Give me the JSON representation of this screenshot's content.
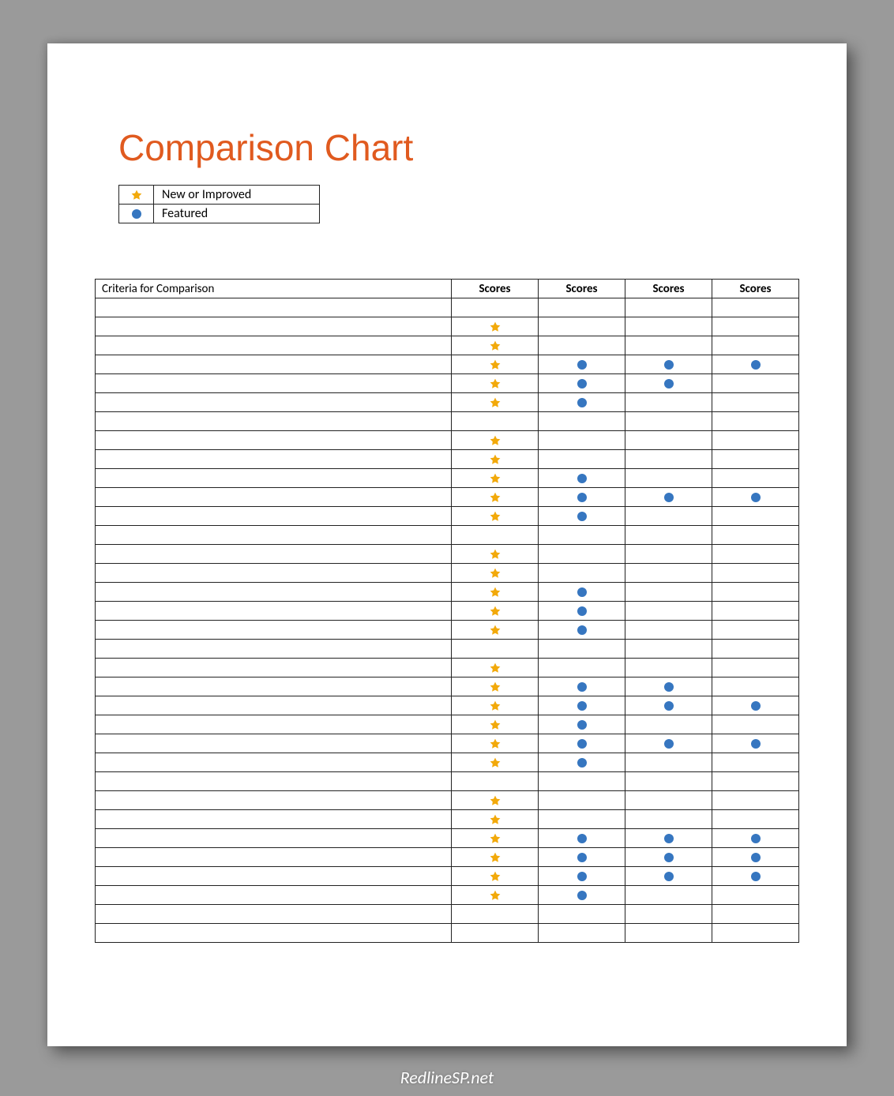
{
  "title": "Comparison Chart",
  "legend": [
    {
      "mark": "star",
      "label": "New or Improved"
    },
    {
      "mark": "dot",
      "label": "Featured"
    }
  ],
  "headers": {
    "criteria": "Criteria for Comparison",
    "scores": [
      "Scores",
      "Scores",
      "Scores",
      "Scores"
    ]
  },
  "rows": [
    {
      "criteria": "",
      "marks": [
        "",
        "",
        "",
        ""
      ]
    },
    {
      "criteria": "",
      "marks": [
        "star",
        "",
        "",
        ""
      ]
    },
    {
      "criteria": "",
      "marks": [
        "star",
        "",
        "",
        ""
      ]
    },
    {
      "criteria": "",
      "marks": [
        "star",
        "dot",
        "dot",
        "dot"
      ]
    },
    {
      "criteria": "",
      "marks": [
        "star",
        "dot",
        "dot",
        ""
      ]
    },
    {
      "criteria": "",
      "marks": [
        "star",
        "dot",
        "",
        ""
      ]
    },
    {
      "criteria": "",
      "marks": [
        "",
        "",
        "",
        ""
      ]
    },
    {
      "criteria": "",
      "marks": [
        "star",
        "",
        "",
        ""
      ]
    },
    {
      "criteria": "",
      "marks": [
        "star",
        "",
        "",
        ""
      ]
    },
    {
      "criteria": "",
      "marks": [
        "star",
        "dot",
        "",
        ""
      ]
    },
    {
      "criteria": "",
      "marks": [
        "star",
        "dot",
        "dot",
        "dot"
      ]
    },
    {
      "criteria": "",
      "marks": [
        "star",
        "dot",
        "",
        ""
      ]
    },
    {
      "criteria": "",
      "marks": [
        "",
        "",
        "",
        ""
      ]
    },
    {
      "criteria": "",
      "marks": [
        "star",
        "",
        "",
        ""
      ]
    },
    {
      "criteria": "",
      "marks": [
        "star",
        "",
        "",
        ""
      ]
    },
    {
      "criteria": "",
      "marks": [
        "star",
        "dot",
        "",
        ""
      ]
    },
    {
      "criteria": "",
      "marks": [
        "star",
        "dot",
        "",
        ""
      ]
    },
    {
      "criteria": "",
      "marks": [
        "star",
        "dot",
        "",
        ""
      ]
    },
    {
      "criteria": "",
      "marks": [
        "",
        "",
        "",
        ""
      ]
    },
    {
      "criteria": "",
      "marks": [
        "star",
        "",
        "",
        ""
      ]
    },
    {
      "criteria": "",
      "marks": [
        "star",
        "dot",
        "dot",
        ""
      ]
    },
    {
      "criteria": "",
      "marks": [
        "star",
        "dot",
        "dot",
        "dot"
      ]
    },
    {
      "criteria": "",
      "marks": [
        "star",
        "dot",
        "",
        ""
      ]
    },
    {
      "criteria": "",
      "marks": [
        "star",
        "dot",
        "dot",
        "dot"
      ]
    },
    {
      "criteria": "",
      "marks": [
        "star",
        "dot",
        "",
        ""
      ]
    },
    {
      "criteria": "",
      "marks": [
        "",
        "",
        "",
        ""
      ]
    },
    {
      "criteria": "",
      "marks": [
        "star",
        "",
        "",
        ""
      ]
    },
    {
      "criteria": "",
      "marks": [
        "star",
        "",
        "",
        ""
      ]
    },
    {
      "criteria": "",
      "marks": [
        "star",
        "dot",
        "dot",
        "dot"
      ]
    },
    {
      "criteria": "",
      "marks": [
        "star",
        "dot",
        "dot",
        "dot"
      ]
    },
    {
      "criteria": "",
      "marks": [
        "star",
        "dot",
        "dot",
        "dot"
      ]
    },
    {
      "criteria": "",
      "marks": [
        "star",
        "dot",
        "",
        ""
      ]
    },
    {
      "criteria": "",
      "marks": [
        "",
        "",
        "",
        ""
      ]
    },
    {
      "criteria": "",
      "marks": [
        "",
        "",
        "",
        ""
      ]
    }
  ],
  "watermark": "RedlineSP.net",
  "colors": {
    "star": "#f2a90a",
    "dot": "#3676c0",
    "title": "#e05a1f"
  }
}
